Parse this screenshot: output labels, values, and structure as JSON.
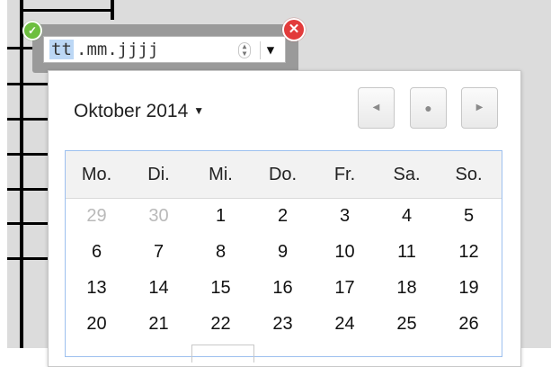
{
  "date_input": {
    "day_placeholder": "tt",
    "rest_placeholder": ".mm.jjjj",
    "spinner_up": "▲",
    "spinner_down": "▼",
    "dropdown_arrow": "▼",
    "ok_icon": "check-icon",
    "ok_glyph": "✓",
    "close_icon": "close-icon",
    "close_glyph": "✕"
  },
  "calendar": {
    "month_label": "Oktober 2014",
    "month_caret": "▼",
    "nav": {
      "prev_glyph": "◀",
      "today_glyph": "●",
      "next_glyph": "▶"
    },
    "weekdays": [
      "Mo.",
      "Di.",
      "Mi.",
      "Do.",
      "Fr.",
      "Sa.",
      "So."
    ],
    "weeks": [
      [
        {
          "d": "29",
          "other": true
        },
        {
          "d": "30",
          "other": true
        },
        {
          "d": "1"
        },
        {
          "d": "2"
        },
        {
          "d": "3"
        },
        {
          "d": "4"
        },
        {
          "d": "5"
        }
      ],
      [
        {
          "d": "6"
        },
        {
          "d": "7"
        },
        {
          "d": "8"
        },
        {
          "d": "9"
        },
        {
          "d": "10"
        },
        {
          "d": "11"
        },
        {
          "d": "12"
        }
      ],
      [
        {
          "d": "13"
        },
        {
          "d": "14"
        },
        {
          "d": "15"
        },
        {
          "d": "16"
        },
        {
          "d": "17"
        },
        {
          "d": "18"
        },
        {
          "d": "19"
        }
      ],
      [
        {
          "d": "20"
        },
        {
          "d": "21"
        },
        {
          "d": "22"
        },
        {
          "d": "23"
        },
        {
          "d": "24"
        },
        {
          "d": "25"
        },
        {
          "d": "26"
        }
      ]
    ]
  },
  "colors": {
    "selection": "#bcd7f5",
    "calendar_border": "#9dc0ef",
    "ok_green": "#6dbf3f",
    "close_red": "#e23b3b"
  }
}
